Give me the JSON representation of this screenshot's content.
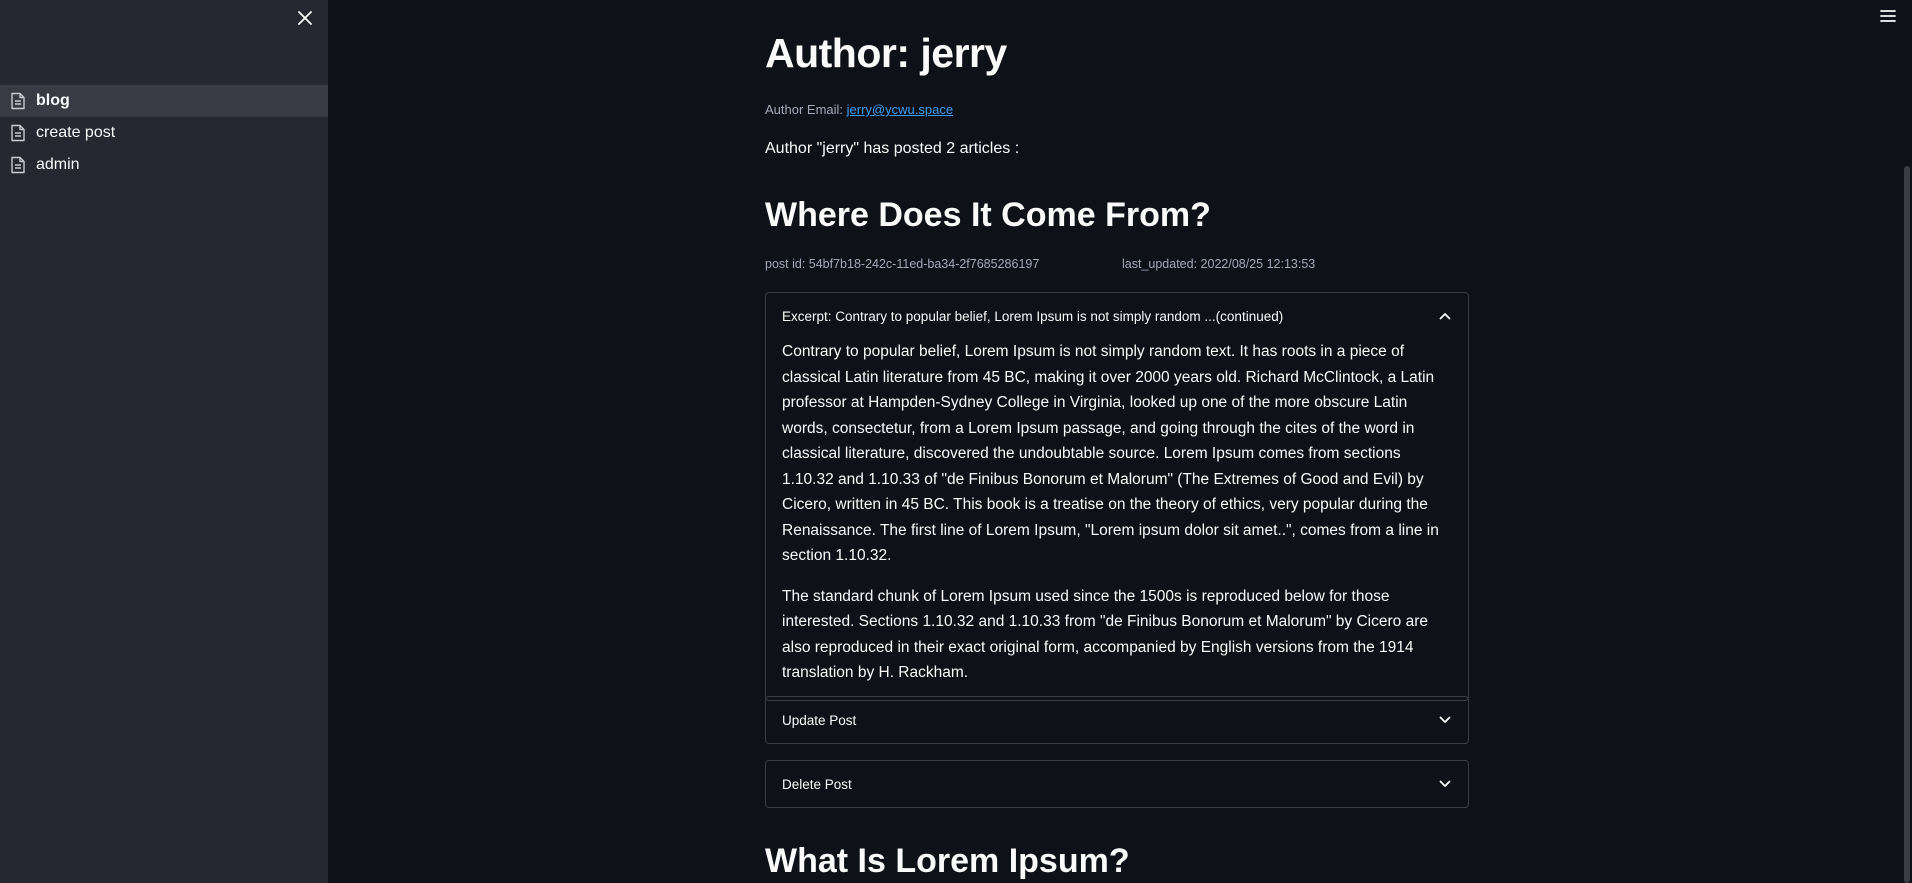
{
  "sidebar": {
    "items": [
      {
        "label": "blog",
        "active": true
      },
      {
        "label": "create post",
        "active": false
      },
      {
        "label": "admin",
        "active": false
      }
    ]
  },
  "author": {
    "title": "Author: jerry",
    "email_label": "Author Email: ",
    "email": "jerry@ycwu.space",
    "count_text": "Author \"jerry\" has posted 2 articles :"
  },
  "post1": {
    "title": "Where Does It Come From?",
    "post_id": "post id: 54bf7b18-242c-11ed-ba34-2f7685286197",
    "last_updated": "last_updated: 2022/08/25 12:13:53",
    "excerpt_label": "Excerpt: Contrary to popular belief, Lorem Ipsum is not simply random ...(continued)",
    "body_p1": "Contrary to popular belief, Lorem Ipsum is not simply random text. It has roots in a piece of classical Latin literature from 45 BC, making it over 2000 years old. Richard McClintock, a Latin professor at Hampden-Sydney College in Virginia, looked up one of the more obscure Latin words, consectetur, from a Lorem Ipsum passage, and going through the cites of the word in classical literature, discovered the undoubtable source. Lorem Ipsum comes from sections 1.10.32 and 1.10.33 of \"de Finibus Bonorum et Malorum\" (The Extremes of Good and Evil) by Cicero, written in 45 BC. This book is a treatise on the theory of ethics, very popular during the Renaissance. The first line of Lorem Ipsum, \"Lorem ipsum dolor sit amet..\", comes from a line in section 1.10.32.",
    "body_p2": "The standard chunk of Lorem Ipsum used since the 1500s is reproduced below for those interested. Sections 1.10.32 and 1.10.33 from \"de Finibus Bonorum et Malorum\" by Cicero are also reproduced in their exact original form, accompanied by English versions from the 1914 translation by H. Rackham.",
    "update_label": "Update Post",
    "delete_label": "Delete Post"
  },
  "post2": {
    "title": "What Is Lorem Ipsum?"
  },
  "icons": {
    "close": "close-icon",
    "menu": "hamburger-menu-icon",
    "page": "document-icon",
    "chevron_up": "chevron-up-icon",
    "chevron_down": "chevron-down-icon"
  },
  "colors": {
    "background": "#0e1117",
    "sidebar": "#262730",
    "sidebar_active": "#393a44",
    "link": "#3d9df3",
    "border": "#3a3c47"
  }
}
